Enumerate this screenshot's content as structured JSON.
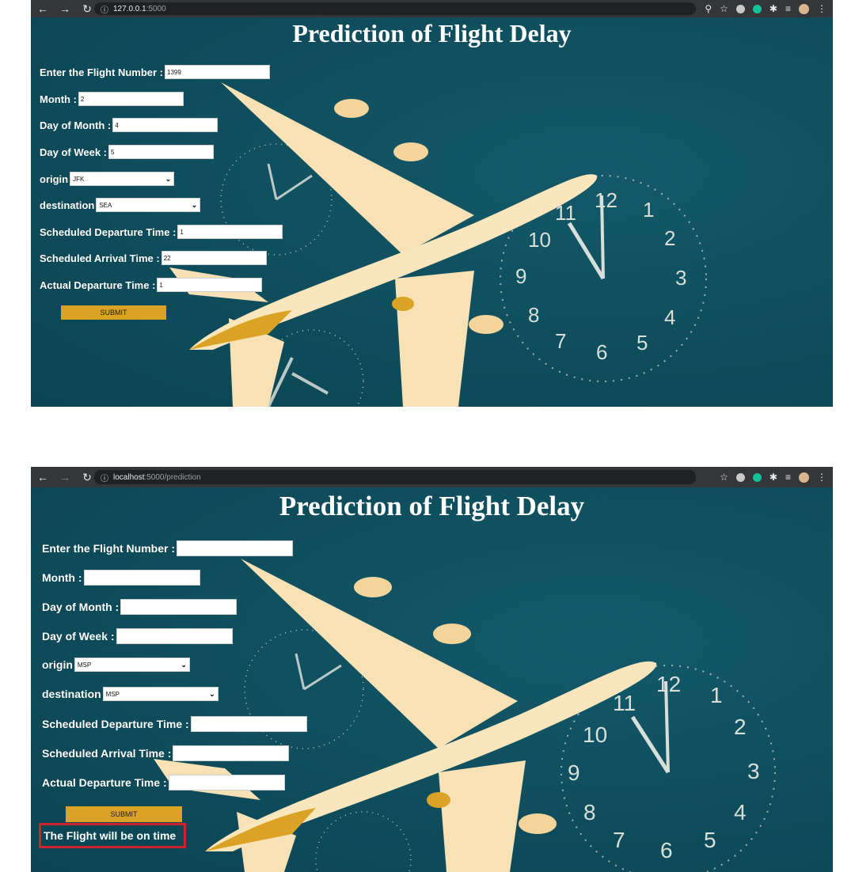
{
  "colors": {
    "page_bg": "#0f4d5c",
    "accent": "#daa325",
    "result_border": "#d1212f",
    "plane": "#f8e2b5"
  },
  "top": {
    "browser": {
      "host": "127.0.0.1",
      "path": ":5000"
    },
    "title": "Prediction of Flight Delay",
    "form": {
      "flight_number_label": "Enter the Flight Number :",
      "flight_number_value": "1399",
      "month_label": "Month :",
      "month_value": "2",
      "day_of_month_label": "Day of Month :",
      "day_of_month_value": "4",
      "day_of_week_label": "Day of Week :",
      "day_of_week_value": "5",
      "origin_label": "origin",
      "origin_value": "JFK",
      "destination_label": "destination",
      "destination_value": "SEA",
      "sched_dep_label": "Scheduled Departure Time :",
      "sched_dep_value": "1",
      "sched_arr_label": "Scheduled Arrival Time :",
      "sched_arr_value": "22",
      "actual_dep_label": "Actual Departure Time :",
      "actual_dep_value": "1",
      "submit_label": "SUBMIT"
    }
  },
  "bottom": {
    "browser": {
      "host": "localhost",
      "path": ":5000/prediction"
    },
    "title": "Prediction of Flight Delay",
    "form": {
      "flight_number_label": "Enter the Flight Number :",
      "flight_number_value": "",
      "month_label": "Month :",
      "month_value": "",
      "day_of_month_label": "Day of Month :",
      "day_of_month_value": "",
      "day_of_week_label": "Day of Week :",
      "day_of_week_value": "",
      "origin_label": "origin",
      "origin_value": "MSP",
      "destination_label": "destination",
      "destination_value": "MSP",
      "sched_dep_label": "Scheduled Departure Time :",
      "sched_dep_value": "",
      "sched_arr_label": "Scheduled Arrival Time :",
      "sched_arr_value": "",
      "actual_dep_label": "Actual Departure Time :",
      "actual_dep_value": "",
      "submit_label": "SUBMIT"
    },
    "result": "The Flight will be on time"
  }
}
